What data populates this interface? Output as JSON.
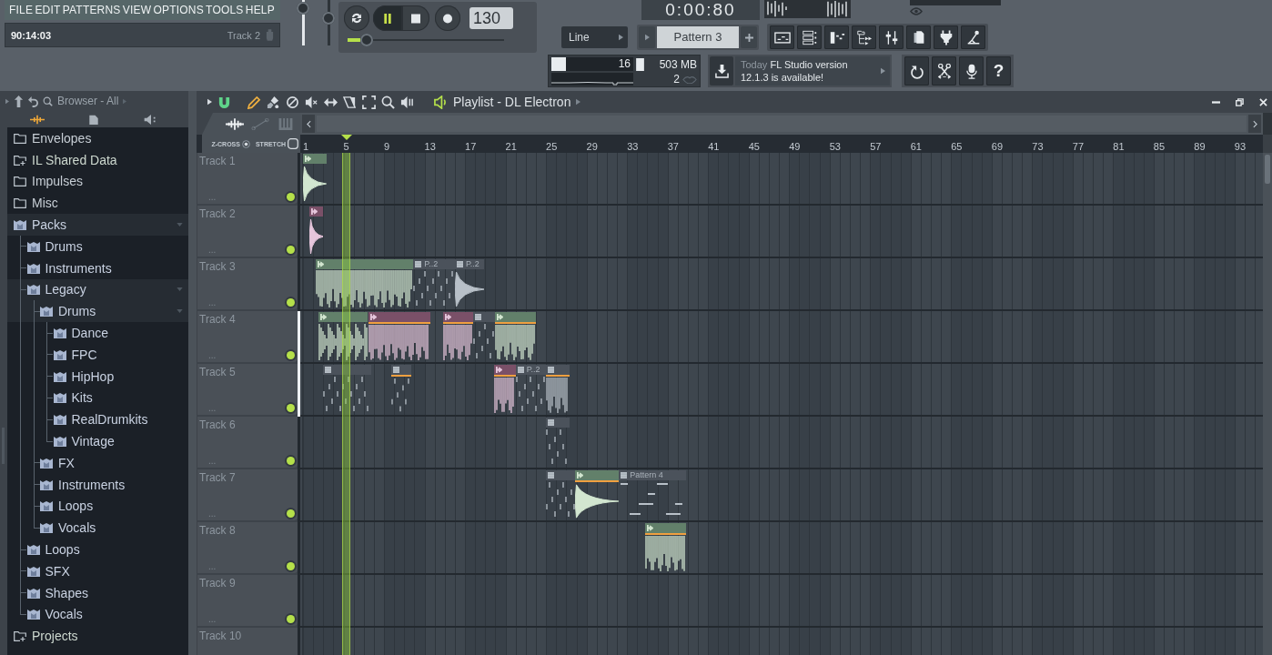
{
  "menu": [
    "FILE",
    "EDIT",
    "PATTERNS",
    "VIEW",
    "OPTIONS",
    "TOOLS",
    "HELP"
  ],
  "hint_bar": {
    "time": "90:14:03",
    "target": "Track 2"
  },
  "master": {
    "volume": {
      "level": 0.95
    },
    "pitch": {
      "level": 0.65
    }
  },
  "transport": {
    "buttons": [
      {
        "kind": "loop",
        "selected": false
      },
      {
        "kind": "pause",
        "selected": true
      },
      {
        "kind": "stop",
        "selected": false
      },
      {
        "kind": "record",
        "selected": false
      }
    ],
    "tempo": "130",
    "position": {
      "level": 0.12
    }
  },
  "time_display": "0:00:80",
  "snap": "Line",
  "pattern": "Pattern 3",
  "usage": {
    "cpu": {
      "level": 0.18,
      "reading": "16"
    },
    "memory": "503 MB",
    "polyphony": "2"
  },
  "news": {
    "date": "Today",
    "title": "FL Studio version",
    "message": "12.1.3 is available!"
  },
  "help_button": "?",
  "browser": {
    "title": "Browser - All",
    "tabs": [
      {
        "kind": "sparkle",
        "selected": true
      },
      {
        "kind": "document",
        "selected": false
      },
      {
        "kind": "speaker",
        "selected": false
      }
    ],
    "tree": [
      {
        "label": "Envelopes",
        "kind": "folder",
        "expanded": false
      },
      {
        "label": "IL Shared Data",
        "kind": "shared-folder",
        "expanded": false
      },
      {
        "label": "Impulses",
        "kind": "folder",
        "expanded": false
      },
      {
        "label": "Misc",
        "kind": "folder",
        "expanded": false
      },
      {
        "label": "Packs",
        "kind": "pack",
        "expanded": true,
        "children": [
          {
            "label": "Drums",
            "kind": "pack",
            "expanded": false
          },
          {
            "label": "Instruments",
            "kind": "pack",
            "expanded": false
          },
          {
            "label": "Legacy",
            "kind": "pack",
            "expanded": true,
            "children": [
              {
                "label": "Drums",
                "kind": "pack",
                "expanded": true,
                "children": [
                  {
                    "label": "Dance",
                    "kind": "pack",
                    "expanded": false
                  },
                  {
                    "label": "FPC",
                    "kind": "pack",
                    "expanded": false
                  },
                  {
                    "label": "HipHop",
                    "kind": "pack",
                    "expanded": false
                  },
                  {
                    "label": "Kits",
                    "kind": "pack",
                    "expanded": false
                  },
                  {
                    "label": "RealDrumkits",
                    "kind": "pack",
                    "expanded": false
                  },
                  {
                    "label": "Vintage",
                    "kind": "pack",
                    "expanded": false
                  }
                ]
              },
              {
                "label": "FX",
                "kind": "pack",
                "expanded": false
              },
              {
                "label": "Instruments",
                "kind": "pack",
                "expanded": false
              },
              {
                "label": "Loops",
                "kind": "pack",
                "expanded": false
              },
              {
                "label": "Vocals",
                "kind": "pack",
                "expanded": false
              }
            ]
          },
          {
            "label": "Loops",
            "kind": "pack",
            "expanded": false
          },
          {
            "label": "SFX",
            "kind": "pack",
            "expanded": false
          },
          {
            "label": "Shapes",
            "kind": "pack",
            "expanded": false
          },
          {
            "label": "Vocals",
            "kind": "pack",
            "expanded": false
          }
        ]
      },
      {
        "label": "Projects",
        "kind": "shared-folder",
        "expanded": false
      }
    ]
  },
  "playlist": {
    "title": "Playlist - DL Electron",
    "view_tabs": [
      {
        "kind": "audio",
        "selected": true
      },
      {
        "kind": "automation",
        "selected": false
      },
      {
        "kind": "piano",
        "selected": false
      }
    ],
    "options": [
      {
        "kind": "radio",
        "label": "Z-CROSS",
        "checked": true
      },
      {
        "kind": "checkbox",
        "label": "STRETCH",
        "checked": false
      }
    ],
    "ruler": [
      "1",
      "5",
      "9",
      "13",
      "17",
      "21",
      "25",
      "29",
      "33",
      "37",
      "41",
      "45",
      "49",
      "53",
      "57",
      "61",
      "65",
      "69",
      "73",
      "77",
      "81",
      "85",
      "89",
      "93"
    ],
    "song_position": {
      "level": 0.048
    },
    "tracks": [
      {
        "name": "Track 1",
        "ellipsis": "...",
        "enabled": true,
        "selected": false
      },
      {
        "name": "Track 2",
        "ellipsis": "...",
        "enabled": true,
        "selected": false
      },
      {
        "name": "Track 3",
        "ellipsis": "...",
        "enabled": true,
        "selected": false,
        "clip_labels": [
          "P..2",
          "P..2"
        ]
      },
      {
        "name": "Track 4",
        "ellipsis": "...",
        "enabled": true,
        "selected": true
      },
      {
        "name": "Track 5",
        "ellipsis": "...",
        "enabled": true,
        "selected": true,
        "clip_labels": [
          "P..2"
        ]
      },
      {
        "name": "Track 6",
        "ellipsis": "...",
        "enabled": true,
        "selected": false
      },
      {
        "name": "Track 7",
        "ellipsis": "...",
        "enabled": true,
        "selected": false,
        "clip_labels": [
          "Pattern 4"
        ]
      },
      {
        "name": "Track 8",
        "ellipsis": "...",
        "enabled": true,
        "selected": false
      },
      {
        "name": "Track 9",
        "ellipsis": "...",
        "enabled": true,
        "selected": false
      },
      {
        "name": "Track 10",
        "selected": false
      }
    ]
  }
}
